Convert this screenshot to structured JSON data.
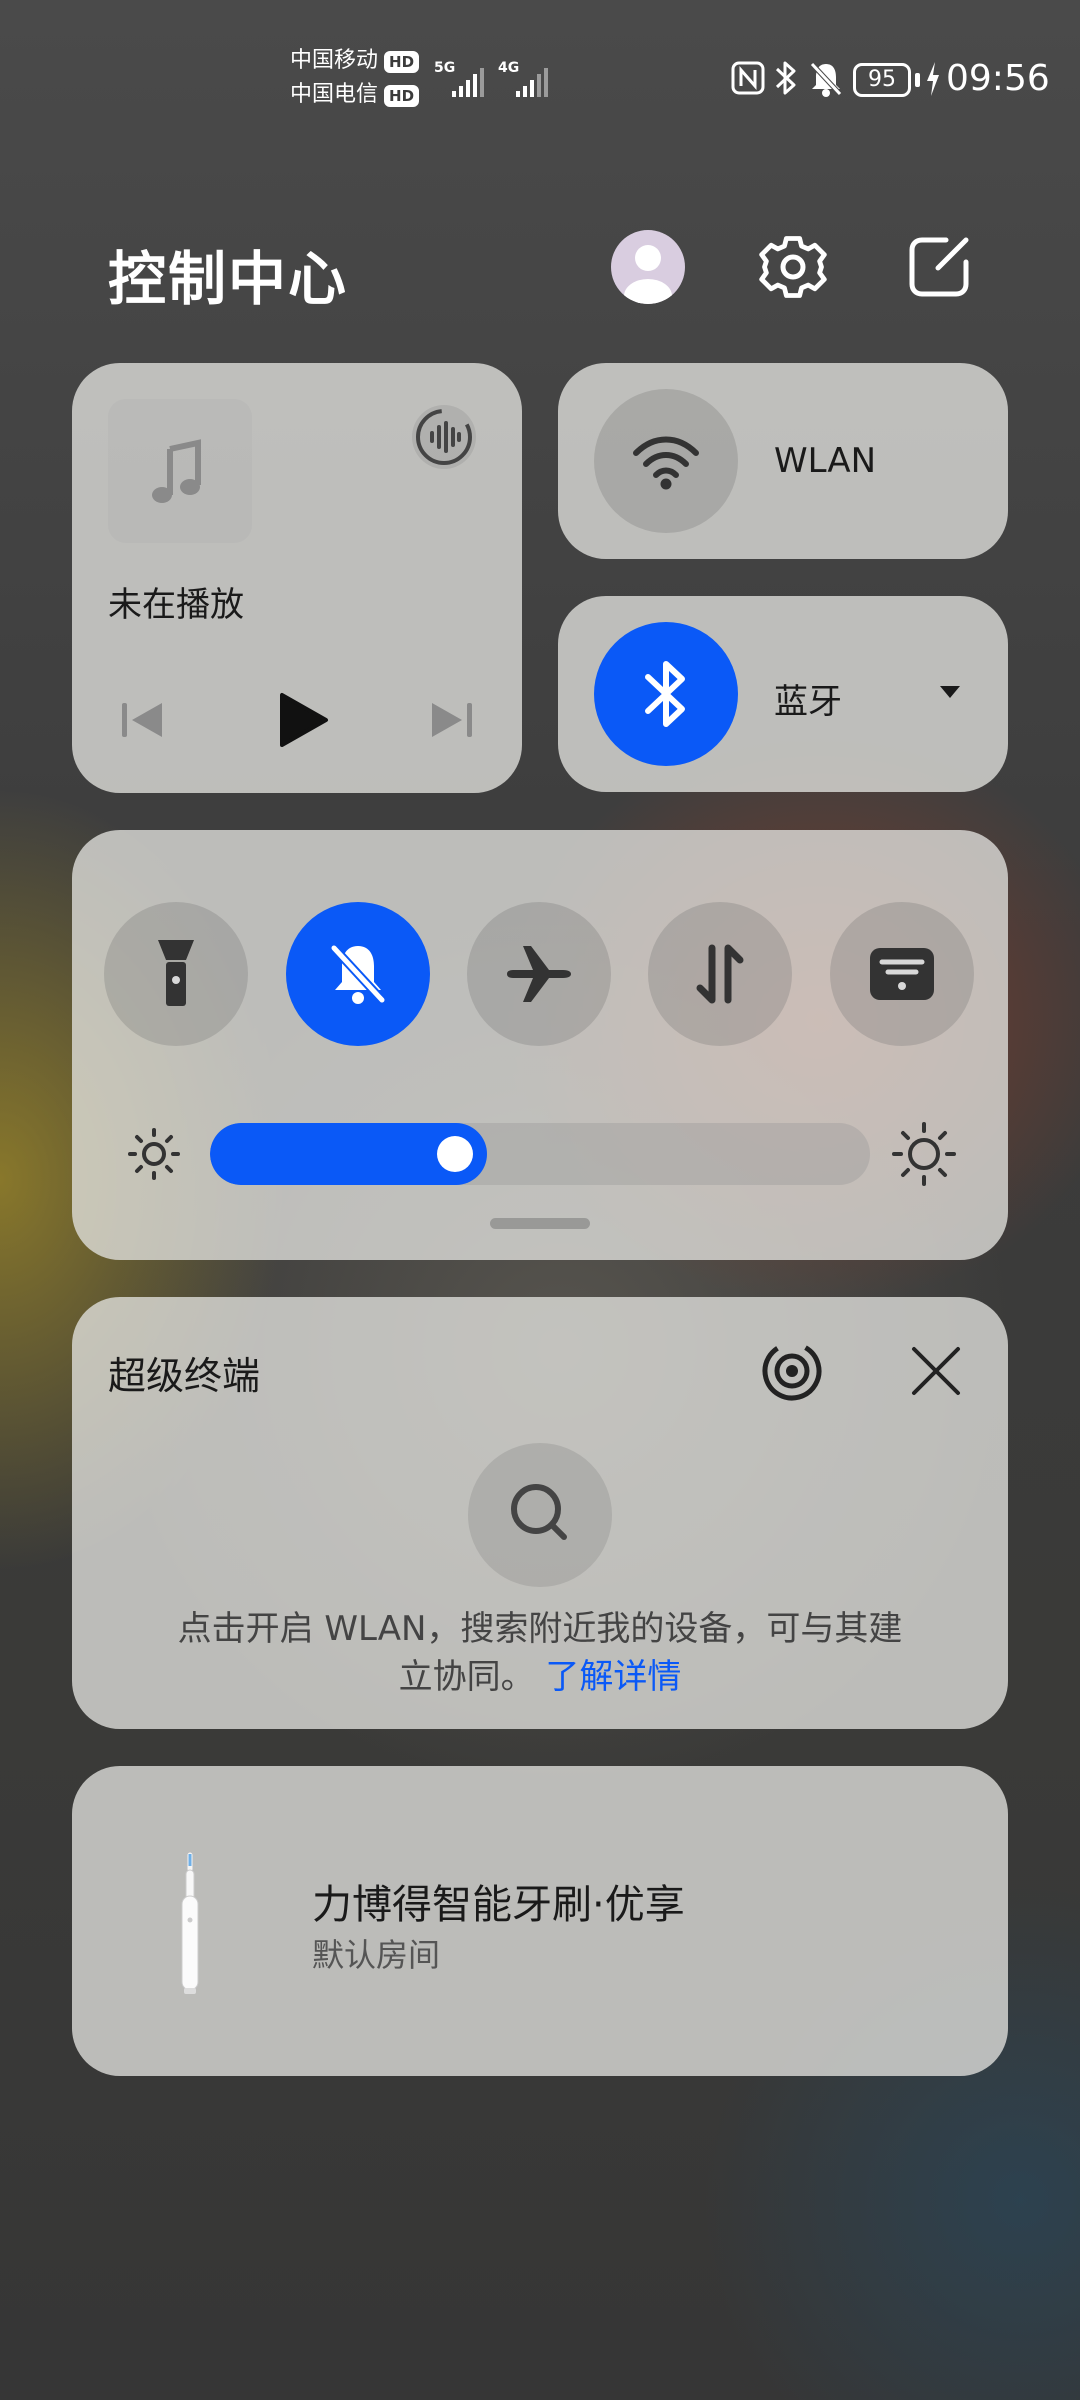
{
  "status_bar": {
    "carrier1": "中国移动",
    "carrier2": "中国电信",
    "hd_badge": "HD",
    "net1": "5G",
    "net2": "4G",
    "battery": "95",
    "time": "09:56"
  },
  "header": {
    "title": "控制中心"
  },
  "media": {
    "status": "未在播放"
  },
  "wlan": {
    "label": "WLAN"
  },
  "bluetooth": {
    "label": "蓝牙"
  },
  "quick_toggles": [
    {
      "name": "flashlight",
      "on": false
    },
    {
      "name": "silent",
      "on": true
    },
    {
      "name": "airplane",
      "on": false
    },
    {
      "name": "mobile-data",
      "on": false
    },
    {
      "name": "message",
      "on": false
    }
  ],
  "brightness": {
    "level": 0.42
  },
  "super_device": {
    "title": "超级终端",
    "hint_line1": "点击开启 WLAN，搜索附近我的设备，可与其建",
    "hint_line2": "立协同。",
    "learn_more": "了解详情"
  },
  "device_card": {
    "name": "力博得智能牙刷·优享",
    "room": "默认房间"
  },
  "colors": {
    "accent": "#0a59f7"
  }
}
